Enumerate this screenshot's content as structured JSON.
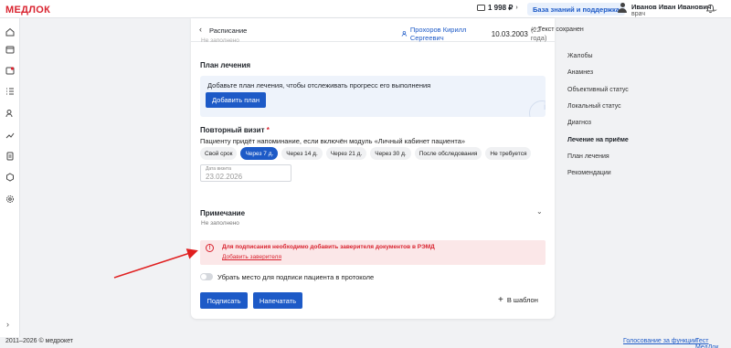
{
  "brand": {
    "logo_text": "МЕДЛОК",
    "accent": "#d9232f",
    "primary": "#1d5ac7"
  },
  "topbar": {
    "balance": "1 998 ₽",
    "kb_button": "База знаний и поддержка",
    "user_name": "Иванов Иван Иванович",
    "user_role": "врач"
  },
  "header": {
    "back_icon": "chevron-left-icon",
    "title": "Расписание",
    "patient_name": "Прохоров Кирилл Сергеевич",
    "patient_dob": "10.03.2003",
    "patient_age": "(22 года)",
    "saved_status": "Текст сохранен"
  },
  "content": {
    "faded_top": "Не заполнено",
    "plan": {
      "title": "План лечения",
      "text": "Добавьте план лечения, чтобы отслеживать прогресс его выполнения",
      "button": "Добавить план"
    },
    "followup": {
      "title": "Повторный визит",
      "required_mark": "*",
      "subtitle": "Пациенту придёт напоминание, если включён модуль «Личный кабинет пациента»",
      "chips": [
        {
          "label": "Свой срок",
          "active": false
        },
        {
          "label": "Через 7 д.",
          "active": true
        },
        {
          "label": "Через 14 д.",
          "active": false
        },
        {
          "label": "Через 21 д.",
          "active": false
        },
        {
          "label": "Через 30 д.",
          "active": false
        },
        {
          "label": "После обследования",
          "active": false
        },
        {
          "label": "Не требуется",
          "active": false
        }
      ],
      "date_label": "Дата визита",
      "date_value": "23.02.2026"
    },
    "note": {
      "title": "Примечание",
      "value": "Не заполнено"
    },
    "alert": {
      "text": "Для подписания необходимо добавить заверителя документов в РЭМД",
      "link": "Добавить заверителя",
      "color": "#d9232f"
    },
    "toggle_label": "Убрать место для подписи пациента в протоколе",
    "actions": {
      "sign": "Подписать",
      "print": "Напечатать",
      "template": "В шаблон"
    }
  },
  "right_nav": [
    {
      "label": "Жалобы",
      "active": false
    },
    {
      "label": "Анамнез",
      "active": false
    },
    {
      "label": "Объективный статус",
      "active": false
    },
    {
      "label": "Локальный статус",
      "active": false
    },
    {
      "label": "Диагноз",
      "active": false
    },
    {
      "label": "Лечение на приёме",
      "active": true
    },
    {
      "label": "План лечения",
      "active": false
    },
    {
      "label": "Рекомендации",
      "active": false
    }
  ],
  "footer": {
    "copyright": "2011–2026 © медрокет",
    "link_vote": "Голосование за функции",
    "link_test": "Тест МедЛок"
  }
}
